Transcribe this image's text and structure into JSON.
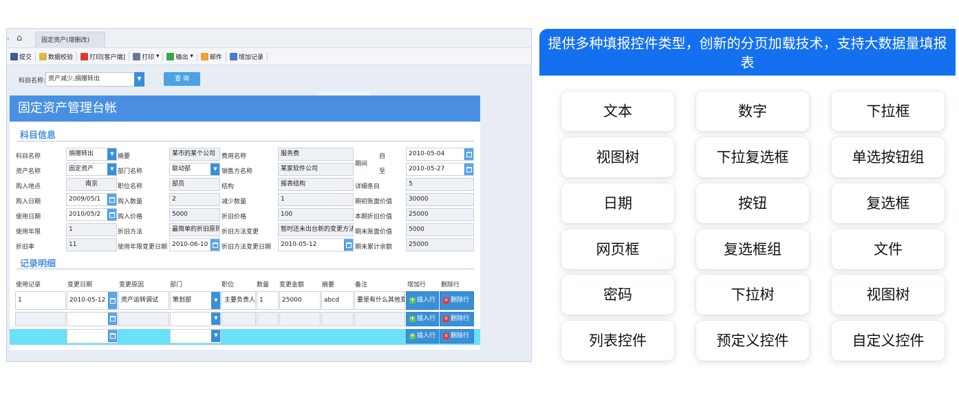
{
  "tabbar": {
    "tab_label": "固定资产(增删改)"
  },
  "toolbar": {
    "items": [
      "提交",
      "数据校验",
      "打印[客户端]",
      "打印",
      "输出",
      "邮件",
      "增加记录"
    ]
  },
  "filter": {
    "label": "科目名称:",
    "value": "资产减少,捐赠转出",
    "query_button": "查 询"
  },
  "form": {
    "title": "固定资产管理台帐",
    "section_subject": "科目信息",
    "section_records": "记录明细",
    "fields": {
      "subject_name_label": "科目名称",
      "subject_name": "捐赠转出",
      "abstract_label": "摘要",
      "abstract": "某市的某个公司",
      "cost_name_label": "费用名称",
      "cost_name": "服务费",
      "period_label": "期间",
      "from_label": "自",
      "from": "2010-05-04",
      "to_label": "至",
      "to": "2010-05-27",
      "asset_name_label": "资产名称",
      "asset_name": "固定资产",
      "dept_name_label": "部门名称",
      "dept_name": "联动部",
      "seller_name_label": "销售方名称",
      "seller_name": "某家软件公司",
      "buy_place_label": "购入地点",
      "buy_place": "南京",
      "job_name_label": "职位名称",
      "job_name": "部员",
      "structure_label": "结构",
      "structure": "报表结构",
      "detail_label": "详细条目",
      "detail": "5",
      "buy_date_label": "购入日期",
      "buy_date": "2009/05/1",
      "buy_qty_label": "购入数量",
      "buy_qty": "2",
      "reduce_qty_label": "减少数量",
      "reduce_qty": "1",
      "begin_value_label": "期初账面价值",
      "begin_value": "30000",
      "use_date_label": "使用日期",
      "use_date": "2010/05/2",
      "buy_price_label": "购入价格",
      "buy_price": "5000",
      "dep_price_label": "折旧价格",
      "dep_price": "100",
      "period_dep_label": "本期折旧价值",
      "period_dep": "25000",
      "use_years_label": "使用年限",
      "use_years": "1",
      "dep_method_label": "折旧方法",
      "dep_method": "最简单的折旧原则",
      "dep_change_label": "折旧方法变更",
      "dep_change": "暂时还未出台新的变更方法",
      "end_value_label": "期末账面价值",
      "end_value": "5000",
      "dep_rate_label": "折旧率",
      "dep_rate": "11",
      "use_change_date_label": "使用年限变更日期",
      "use_change_date": "2010-06-10",
      "dep_change_date_label": "折旧方法变更日期",
      "dep_change_date": "2010-05-12",
      "end_total_label": "期末累计余额",
      "end_total": "25000"
    },
    "records": {
      "headers": [
        "使用记录",
        "变更日期",
        "变更原因",
        "部门",
        "职位",
        "数量",
        "变更金额",
        "摘要",
        "备注",
        "增加行",
        "删除行"
      ],
      "row1": [
        "1",
        "2010-05-12",
        "资产运转调试",
        "策划部",
        "主要负责人",
        "1",
        "25000",
        "abcd",
        "要是有什么其他变"
      ],
      "insert_label": "插入行",
      "delete_label": "删除行"
    }
  },
  "banner": {
    "text": "提供多种填报控件类型，创新的分页加载技术，支持大数据量填报表"
  },
  "controls": [
    "文本",
    "数字",
    "下拉框",
    "视图树",
    "下拉复选框",
    "单选按钮组",
    "日期",
    "按钮",
    "复选框",
    "网页框",
    "复选框组",
    "文件",
    "密码",
    "下拉树",
    "视图树",
    "列表控件",
    "预定义控件",
    "自定义控件"
  ]
}
